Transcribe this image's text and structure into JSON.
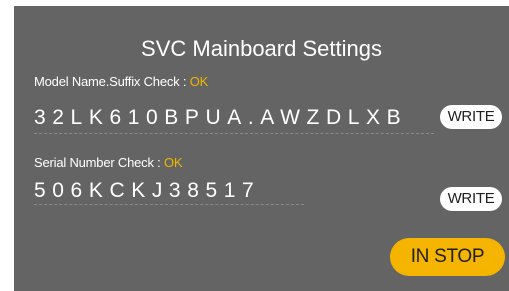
{
  "dialog": {
    "title": "SVC Mainboard Settings"
  },
  "model": {
    "label": "Model Name.Suffix Check : ",
    "status": "OK",
    "value": "32LK610BPUA.AWZDLXB",
    "button": "WRITE"
  },
  "serial": {
    "label": "Serial Number Check : ",
    "status": "OK",
    "value": "506KCKJ38517",
    "button": "WRITE"
  },
  "actions": {
    "stop_button": "IN STOP"
  },
  "colors": {
    "panel": "#646464",
    "status_ok": "#f0b400",
    "stop_button": "#f4b400"
  }
}
